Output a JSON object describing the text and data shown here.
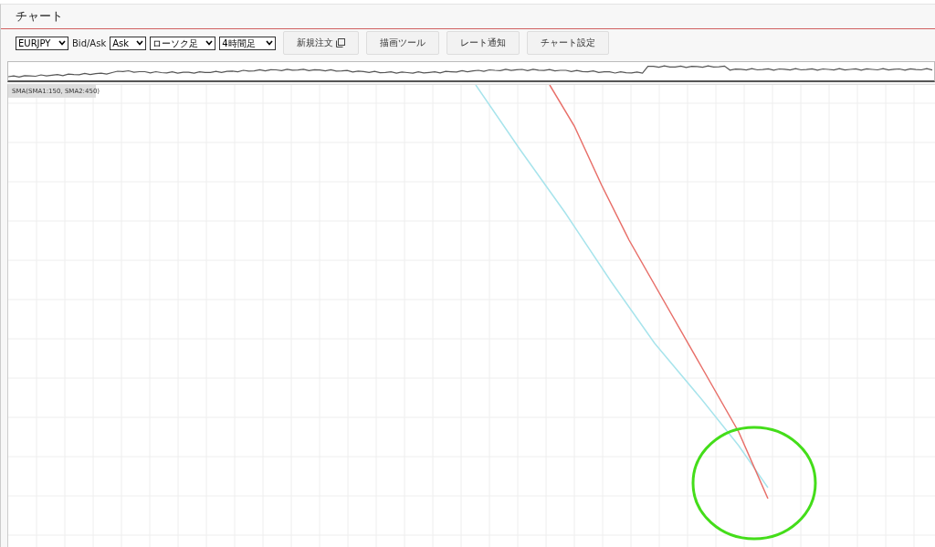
{
  "panel": {
    "title": "チャート"
  },
  "toolbar": {
    "symbol": {
      "value": "EURJPY"
    },
    "side_label": "Bid/Ask",
    "side": {
      "value": "Ask"
    },
    "chart_type": {
      "value": "ローソク足"
    },
    "timeframe": {
      "value": "4時間足"
    },
    "buttons": [
      {
        "label": "新規注文",
        "kind": "popup"
      },
      {
        "label": "描画ツール",
        "kind": "plain"
      },
      {
        "label": "レート通知",
        "kind": "plain"
      },
      {
        "label": "チャート設定",
        "kind": "plain"
      }
    ]
  },
  "chart": {
    "indicator_label": "SMA(SMA1:150, SMA2:450)"
  }
}
